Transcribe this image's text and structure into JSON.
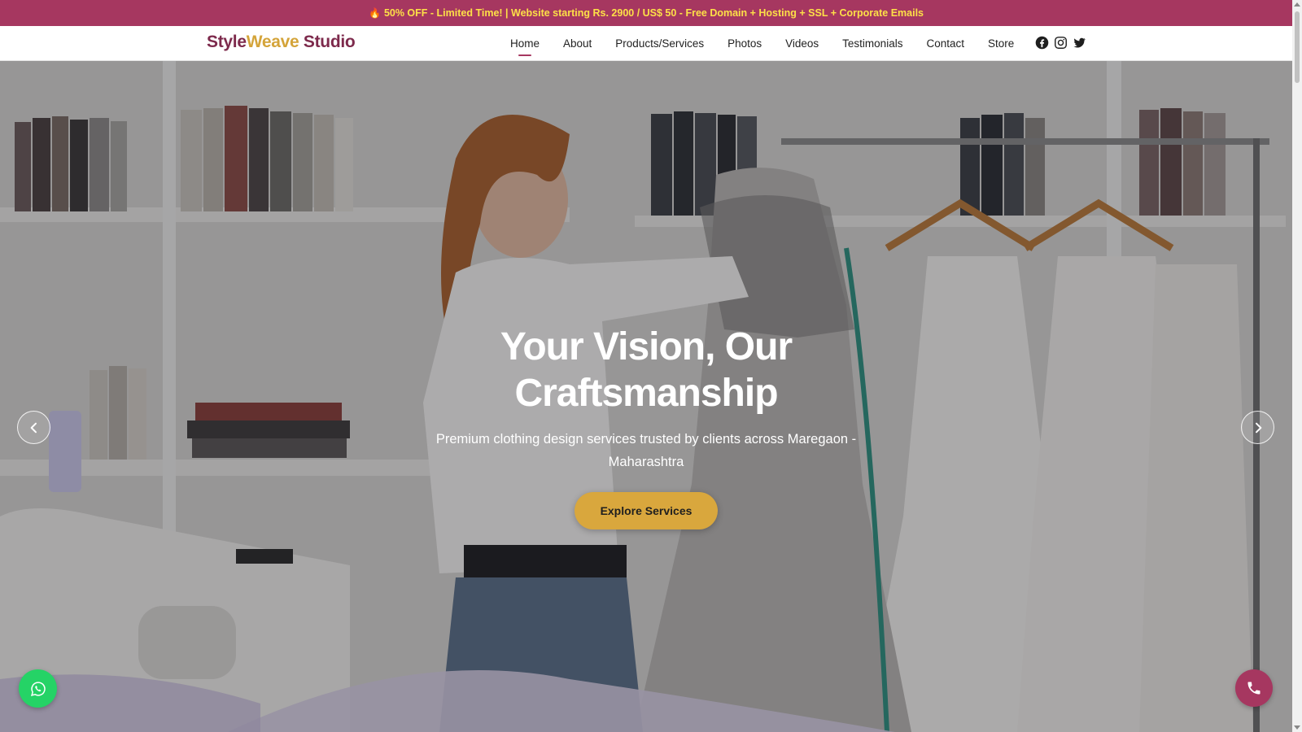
{
  "promo": {
    "icon": "fire-icon",
    "text": "50% OFF - Limited Time! | Website starting Rs. 2900 / US$ 50 - Free Domain + Hosting + SSL + Corporate Emails"
  },
  "brand": {
    "part1": "Style",
    "part2": "Weave",
    "part3": " Studio"
  },
  "nav": {
    "items": [
      {
        "label": "Home",
        "active": true
      },
      {
        "label": "About"
      },
      {
        "label": "Products/Services"
      },
      {
        "label": "Photos"
      },
      {
        "label": "Videos"
      },
      {
        "label": "Testimonials"
      },
      {
        "label": "Contact"
      },
      {
        "label": "Store"
      }
    ],
    "social": [
      "facebook-icon",
      "instagram-icon",
      "twitter-icon"
    ]
  },
  "hero": {
    "title_line1": "Your Vision, Our",
    "title_line2": "Craftsmanship",
    "subtitle_line1": "Premium clothing design services trusted by clients across Maregaon -",
    "subtitle_line2": "Maharashtra",
    "cta_label": "Explore Services"
  },
  "colors": {
    "promo_bg": "#a63760",
    "promo_text": "#fde047",
    "brand_primary": "#7d2a4c",
    "brand_accent": "#d4a43a",
    "cta_bg": "#d9a73d",
    "whatsapp": "#25d366"
  }
}
